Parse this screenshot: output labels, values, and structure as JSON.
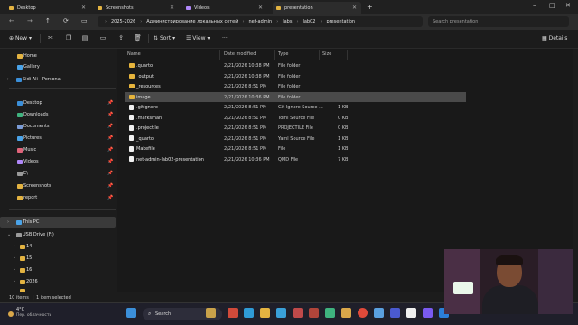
{
  "tabs": [
    {
      "label": "Desktop",
      "type": "folder"
    },
    {
      "label": "Screenshots",
      "type": "folder"
    },
    {
      "label": "Videos",
      "type": "video"
    },
    {
      "label": "presentation",
      "type": "folder",
      "active": true
    }
  ],
  "breadcrumb": [
    "2025-2026",
    "Администрирование локальных сетей",
    "net-admin",
    "labs",
    "lab02",
    "presentation"
  ],
  "search_placeholder": "Search presentation",
  "toolbar": {
    "new_label": "New",
    "sort_label": "Sort",
    "view_label": "View",
    "more_label": "···",
    "details_label": "Details"
  },
  "sidebar": {
    "top": [
      {
        "label": "Home",
        "color": "#e3b341"
      },
      {
        "label": "Gallery",
        "color": "#4aa3e8"
      },
      {
        "label": "Sidi Ali - Personal",
        "color": "#3b8fd9",
        "expand": true
      }
    ],
    "quick": [
      {
        "label": "Desktop",
        "color": "#3b8fd9"
      },
      {
        "label": "Downloads",
        "color": "#3fb37f"
      },
      {
        "label": "Documents",
        "color": "#7a9bd6"
      },
      {
        "label": "Pictures",
        "color": "#4aa3e8"
      },
      {
        "label": "Music",
        "color": "#e0647a"
      },
      {
        "label": "Videos",
        "color": "#b088f9"
      },
      {
        "label": "E\\",
        "color": "#9a9a9a"
      },
      {
        "label": "Screenshots",
        "color": "#e3b341"
      },
      {
        "label": "report",
        "color": "#e3b341"
      }
    ],
    "drives": [
      {
        "label": "This PC",
        "color": "#4aa3e8",
        "selected": true
      },
      {
        "label": "USB Drive (F:)",
        "color": "#9a9a9a",
        "expanded": true
      },
      {
        "label": "14",
        "color": "#e3b341"
      },
      {
        "label": "15",
        "color": "#e3b341"
      },
      {
        "label": "16",
        "color": "#e3b341"
      },
      {
        "label": "2026",
        "color": "#e3b341"
      },
      {
        "label": "...",
        "color": "#e3b341"
      }
    ]
  },
  "columns": {
    "name": "Name",
    "date": "Date modified",
    "type": "Type",
    "size": "Size"
  },
  "files": [
    {
      "name": ".quarto",
      "date": "2/21/2026 10:38 PM",
      "type": "File folder",
      "size": "",
      "kind": "folder"
    },
    {
      "name": "_output",
      "date": "2/21/2026 10:38 PM",
      "type": "File folder",
      "size": "",
      "kind": "folder"
    },
    {
      "name": "_resources",
      "date": "2/21/2026 8:51 PM",
      "type": "File folder",
      "size": "",
      "kind": "folder"
    },
    {
      "name": "image",
      "date": "2/21/2026 10:36 PM",
      "type": "File folder",
      "size": "",
      "kind": "folder",
      "selected": true
    },
    {
      "name": ".gitignore",
      "date": "2/21/2026 8:51 PM",
      "type": "Git Ignore Source ...",
      "size": "1 KB",
      "kind": "file"
    },
    {
      "name": ".marksman",
      "date": "2/21/2026 8:51 PM",
      "type": "Toml Source File",
      "size": "0 KB",
      "kind": "file"
    },
    {
      "name": ".projectile",
      "date": "2/21/2026 8:51 PM",
      "type": "PROJECTILE File",
      "size": "0 KB",
      "kind": "file"
    },
    {
      "name": "_quarto",
      "date": "2/21/2026 8:51 PM",
      "type": "Yaml Source File",
      "size": "1 KB",
      "kind": "file"
    },
    {
      "name": "Makefile",
      "date": "2/21/2026 8:51 PM",
      "type": "File",
      "size": "1 KB",
      "kind": "file"
    },
    {
      "name": "net-admin-lab02-presentation",
      "date": "2/21/2026 10:36 PM",
      "type": "QMD File",
      "size": "7 KB",
      "kind": "file"
    }
  ],
  "status": {
    "count": "10 items",
    "selected": "1 item selected"
  },
  "taskbar": {
    "temp": "4°C",
    "condition": "Пер. облачность",
    "search": "Search"
  }
}
